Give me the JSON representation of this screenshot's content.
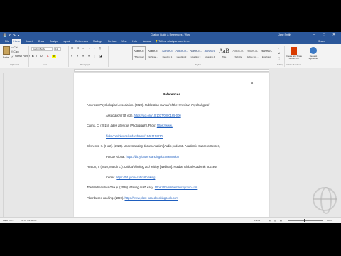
{
  "window": {
    "title": "Citation Guide & References - Word",
    "user": "Jane Smith",
    "minimize": "–",
    "maximize": "□",
    "close": "✕",
    "qat": "💾 ↶ ↷ ▾"
  },
  "tabs": [
    "File",
    "Home",
    "Insert",
    "Draw",
    "Design",
    "Layout",
    "References",
    "Mailings",
    "Review",
    "View",
    "Help",
    "Acrobat"
  ],
  "tell_me": "Tell me what you want to do",
  "share_label": "Share",
  "ribbon": {
    "clipboard": {
      "paste": "Paste",
      "cut": "✂ Cut",
      "copy": "⎘ Copy",
      "painter": "🖌 Format Painter",
      "group": "Clipboard"
    },
    "font": {
      "name": "Calibri (Body)",
      "size": "11",
      "bold": "B",
      "italic": "I",
      "underline": "U",
      "group": "Font"
    },
    "paragraph": {
      "group": "Paragraph"
    },
    "styles": {
      "group": "Styles",
      "items": [
        {
          "sample": "AaBbCcI",
          "name": "¶ Normal"
        },
        {
          "sample": "AaBbCcI",
          "name": "No Spac..."
        },
        {
          "sample": "AaBbCc",
          "name": "Heading 1"
        },
        {
          "sample": "AaBbCcC",
          "name": "Heading 2"
        },
        {
          "sample": "AaBbCcC",
          "name": "Heading 3"
        },
        {
          "sample": "AaBbCcL",
          "name": "Heading 4"
        },
        {
          "sample": "AaB",
          "name": "Title"
        },
        {
          "sample": "AaBbCcC",
          "name": "Subtitle"
        },
        {
          "sample": "AaBbCcL",
          "name": "Subtle Em..."
        },
        {
          "sample": "AaBbCcL",
          "name": "Emphasis"
        }
      ]
    },
    "editing": {
      "group": "Editing"
    },
    "adobe": {
      "label": "Create and Share Adobe PDF",
      "group": "Adobe Acrobat"
    },
    "voice": {
      "label": "Request Signatures",
      "group": ""
    }
  },
  "document": {
    "page_number": "8",
    "title": "References",
    "references": [
      {
        "lines": [
          [
            {
              "t": "American Psychological Association. (2020). "
            },
            {
              "t": "Publication manual of the American Psychological",
              "s": "i"
            }
          ],
          [
            {
              "t": "Association",
              "s": "i"
            },
            {
              "t": " (7th ed.). "
            },
            {
              "t": "https://doi.org/10.1037/0000165-000",
              "s": "l"
            }
          ]
        ]
      },
      {
        "lines": [
          [
            {
              "t": "Cairns, C. (2015). "
            },
            {
              "t": "Lilies after rain",
              "s": "i"
            },
            {
              "t": " [Photograph]. Flickr. "
            },
            {
              "t": "https://www.",
              "s": "l"
            }
          ],
          [
            {
              "t": "flickr.com/photos/cedarsbarns/19461114230/",
              "s": "l"
            }
          ]
        ]
      },
      {
        "lines": [
          [
            {
              "t": "Clements, K. (Host). (2020). "
            },
            {
              "t": "Understanding documentation",
              "s": "i"
            },
            {
              "t": " [Audio podcast]. Academic Success Center,"
            }
          ],
          [
            {
              "t": "Purdue Global. "
            },
            {
              "t": "https://bit.ly/understandingdocumentation",
              "s": "l"
            }
          ]
        ]
      },
      {
        "lines": [
          [
            {
              "t": "Huston, T. (2020, March 17). "
            },
            {
              "t": "Critical thinking and writing",
              "s": "i"
            },
            {
              "t": " [Webinar]. Purdue Global Academic Success"
            }
          ],
          [
            {
              "t": "Center. "
            },
            {
              "t": "https://bit.ly/cvv-criticalthinking",
              "s": "l"
            }
          ]
        ]
      },
      {
        "lines": [
          [
            {
              "t": "The Mathematics Group. (2020). "
            },
            {
              "t": "Making math easy",
              "s": "i"
            },
            {
              "t": ". "
            },
            {
              "t": "https://themathematicsgroup.com",
              "s": "l"
            }
          ]
        ]
      },
      {
        "lines": [
          [
            {
              "t": "Plant-based cooking",
              "s": "i"
            },
            {
              "t": ". (2020). "
            },
            {
              "t": "https://www.plant-basedcookingbook.com",
              "s": "l"
            }
          ]
        ]
      }
    ]
  },
  "status": {
    "page": "Page 8 of 8",
    "words": "45 of 712 words",
    "focus": "Focus",
    "zoom": "100%"
  }
}
